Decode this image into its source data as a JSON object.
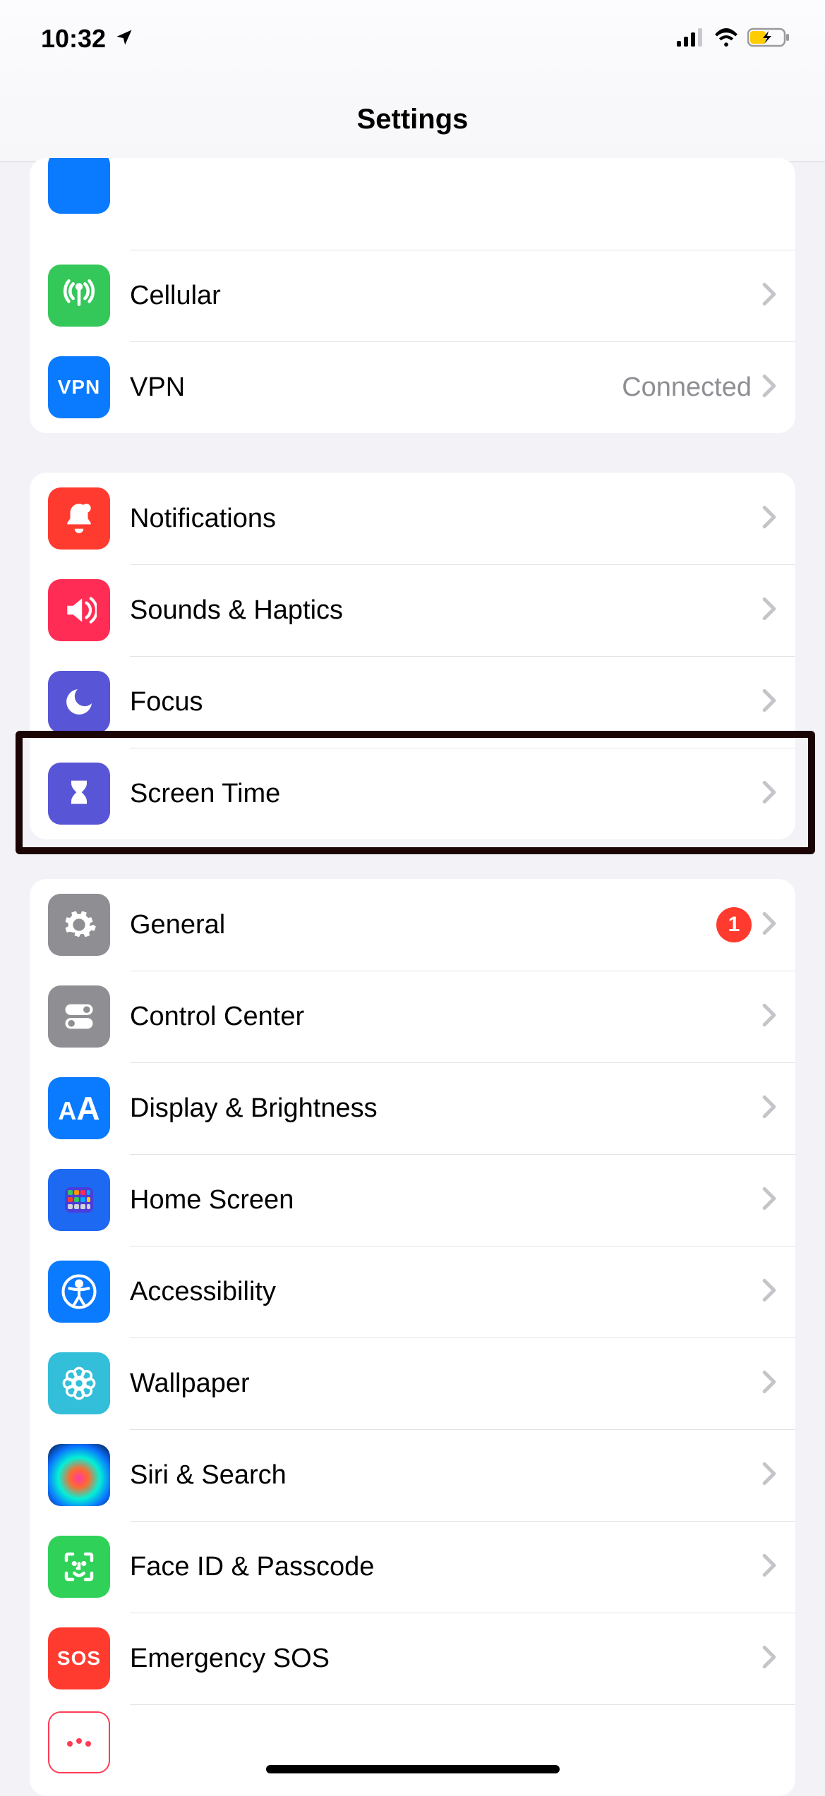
{
  "status": {
    "time": "10:32"
  },
  "header": {
    "title": "Settings"
  },
  "groups": [
    {
      "rows": [
        {
          "id": "cellular",
          "label": "Cellular"
        },
        {
          "id": "vpn",
          "label": "VPN",
          "value": "Connected"
        }
      ]
    },
    {
      "rows": [
        {
          "id": "notifications",
          "label": "Notifications"
        },
        {
          "id": "sounds",
          "label": "Sounds & Haptics"
        },
        {
          "id": "focus",
          "label": "Focus"
        },
        {
          "id": "screentime",
          "label": "Screen Time"
        }
      ]
    },
    {
      "rows": [
        {
          "id": "general",
          "label": "General",
          "badge": "1"
        },
        {
          "id": "controlcenter",
          "label": "Control Center"
        },
        {
          "id": "display",
          "label": "Display & Brightness"
        },
        {
          "id": "homescreen",
          "label": "Home Screen"
        },
        {
          "id": "accessibility",
          "label": "Accessibility"
        },
        {
          "id": "wallpaper",
          "label": "Wallpaper"
        },
        {
          "id": "siri",
          "label": "Siri & Search"
        },
        {
          "id": "faceid",
          "label": "Face ID & Passcode"
        },
        {
          "id": "sos",
          "label": "Emergency SOS"
        }
      ]
    }
  ],
  "highlight": {
    "row_id": "screentime"
  }
}
